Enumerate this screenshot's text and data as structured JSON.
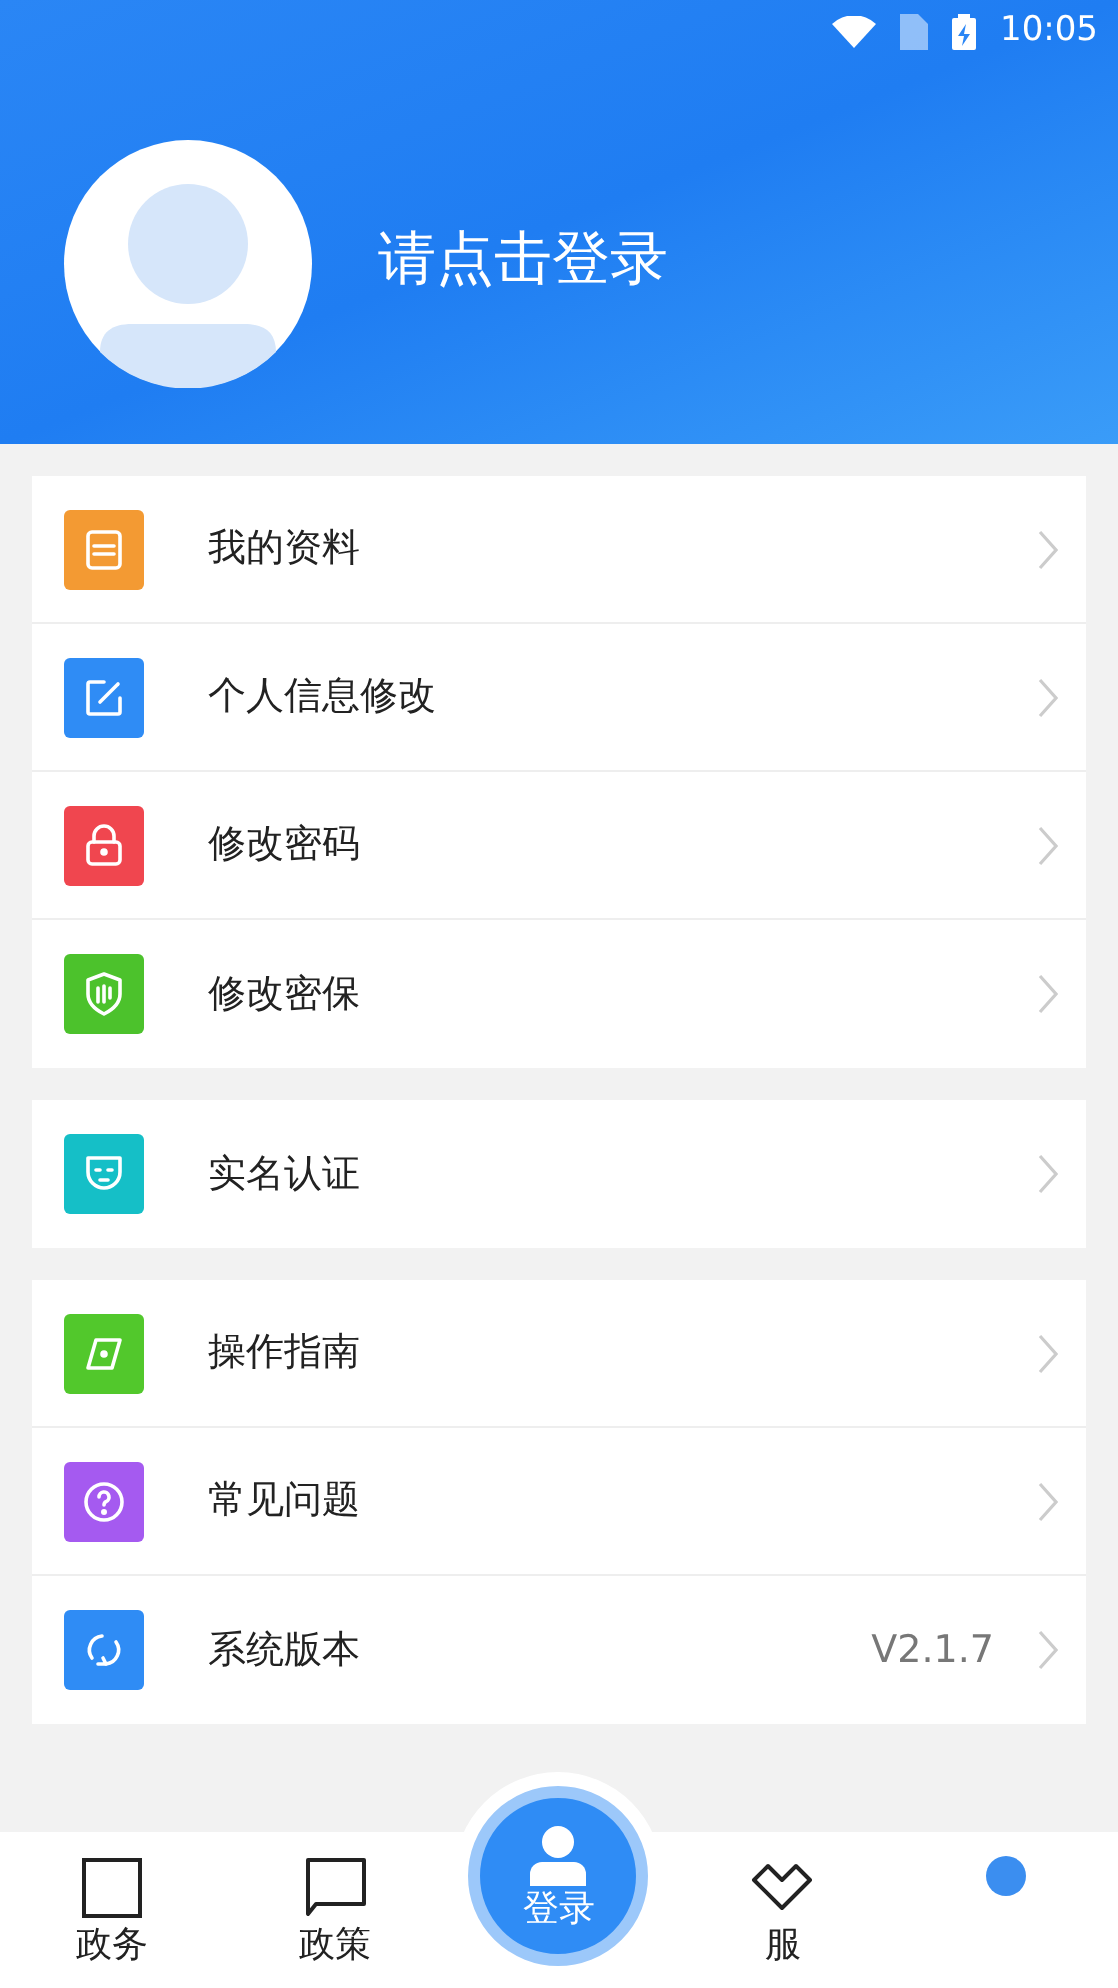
{
  "status_bar": {
    "time": "10:05"
  },
  "header": {
    "login_prompt": "请点击登录"
  },
  "menu_groups": [
    {
      "items": [
        {
          "label": "我的资料",
          "kind": "document",
          "color": "#f39a33"
        },
        {
          "label": "个人信息修改",
          "kind": "edit",
          "color": "#2f8cf5"
        },
        {
          "label": "修改密码",
          "kind": "lock",
          "color": "#f0464f"
        },
        {
          "label": "修改密保",
          "kind": "shield",
          "color": "#4cc22c"
        }
      ]
    },
    {
      "items": [
        {
          "label": "实名认证",
          "kind": "face",
          "color": "#15bfc7"
        }
      ]
    },
    {
      "items": [
        {
          "label": "操作指南",
          "kind": "compass",
          "color": "#52c82c"
        },
        {
          "label": "常见问题",
          "kind": "question",
          "color": "#a55af0"
        },
        {
          "label": "系统版本",
          "kind": "refresh",
          "color": "#2f8cf5",
          "value": "V2.1.7"
        }
      ]
    }
  ],
  "tab_bar": [
    {
      "kind": "square",
      "label": "政务"
    },
    {
      "kind": "bubble",
      "label": "政策"
    },
    {
      "kind": "center",
      "label": "登录"
    },
    {
      "kind": "heart",
      "label": "服"
    },
    {
      "kind": "dot"
    }
  ]
}
